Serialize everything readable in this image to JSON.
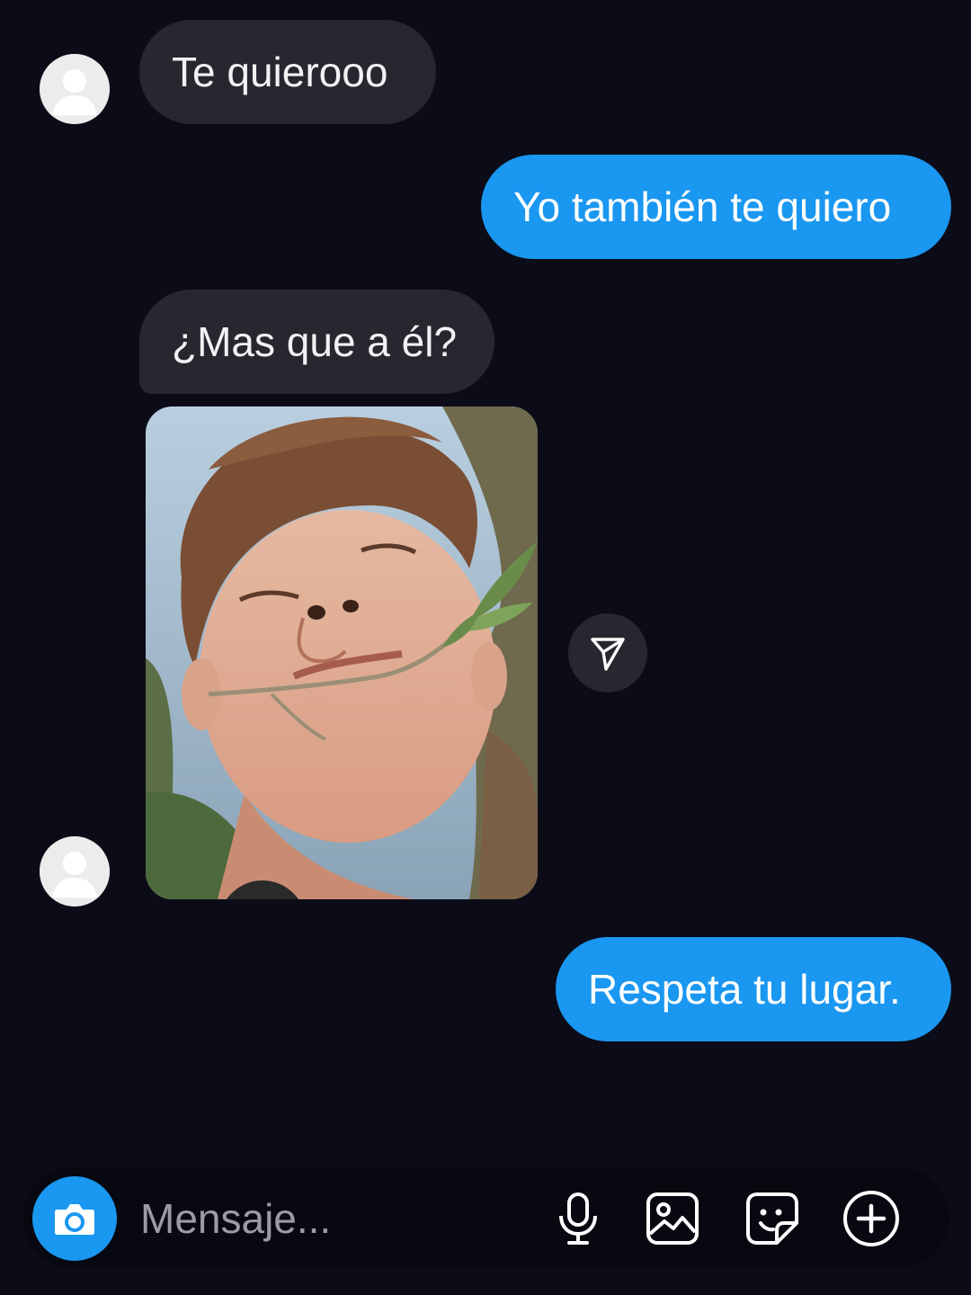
{
  "conversation": {
    "messages": [
      {
        "direction": "incoming",
        "type": "text",
        "text": "Te quierooo"
      },
      {
        "direction": "outgoing",
        "type": "text",
        "text": "Yo también te quiero"
      },
      {
        "direction": "incoming",
        "type": "text",
        "text": "¿Mas que a él?"
      },
      {
        "direction": "incoming",
        "type": "photo",
        "icon": "paper-plane-icon"
      },
      {
        "direction": "outgoing",
        "type": "text",
        "text": "Respeta tu lugar."
      }
    ]
  },
  "composer": {
    "placeholder": "Mensaje...",
    "icons": [
      "camera-icon",
      "microphone-icon",
      "gallery-icon",
      "sticker-icon",
      "plus-circle-icon"
    ]
  },
  "colors": {
    "background": "#0b0c18",
    "incoming_bubble": "#26272f",
    "outgoing_bubble": "#1a97f0",
    "text": "#f2f2f4"
  }
}
